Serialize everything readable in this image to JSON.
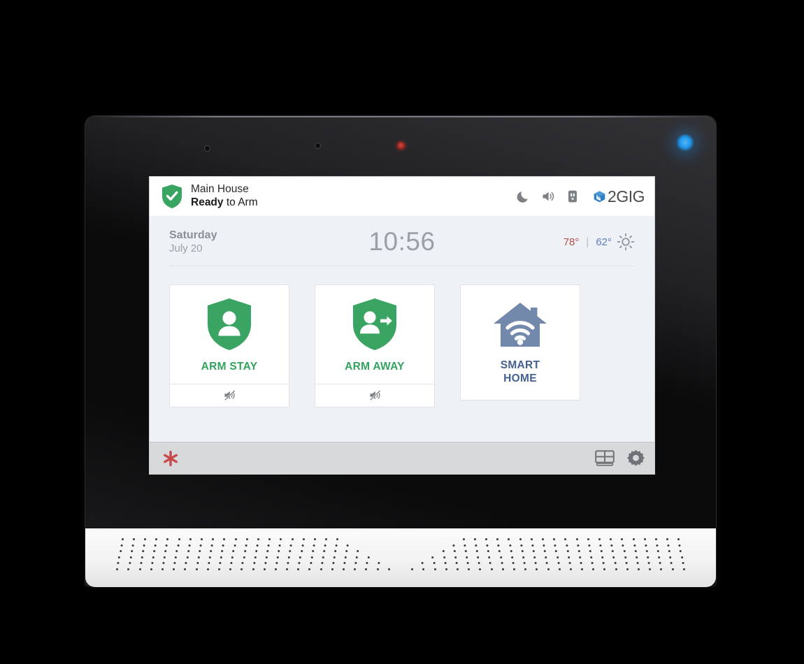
{
  "device": {
    "brand": "2GIG",
    "indicators": {
      "led_blue": "blue-status-led",
      "led_red": "red-status-led",
      "sensor_1": "ambient-light-sensor",
      "sensor_2": "microphone-hole"
    }
  },
  "header": {
    "site_name": "Main House",
    "status_prefix": "Ready",
    "status_suffix": " to Arm",
    "shield_icon": "shield-check-icon",
    "icons": [
      {
        "name": "night-mode-icon",
        "glyph": "moon"
      },
      {
        "name": "volume-icon",
        "glyph": "speaker"
      },
      {
        "name": "power-outlet-icon",
        "glyph": "outlet"
      }
    ],
    "brand_text": "2GIG",
    "brand_mark": "2gig-cube-logo"
  },
  "info_bar": {
    "day": "Saturday",
    "date": "July 20",
    "time": "10:56",
    "temp_high": "78°",
    "temp_divider": "|",
    "temp_low": "62°",
    "weather_icon": "sun-icon",
    "colors": {
      "temp_high": "#b5534b",
      "temp_low": "#5b7fbd"
    }
  },
  "tiles": [
    {
      "id": "arm-stay",
      "label": "ARM STAY",
      "icon": "shield-person-icon",
      "color": "#34a35f",
      "footer_icon": "mute-speaker-icon",
      "has_footer": true
    },
    {
      "id": "arm-away",
      "label": "ARM AWAY",
      "icon": "shield-person-arrow-icon",
      "color": "#34a35f",
      "footer_icon": "mute-speaker-icon",
      "has_footer": true
    },
    {
      "id": "smart-home",
      "label_line1": "SMART",
      "label_line2": "HOME",
      "icon": "house-wifi-icon",
      "color": "#44618f",
      "has_footer": false
    }
  ],
  "bottom_bar": {
    "emergency_icon": "emergency-asterisk-icon",
    "emergency_color": "#c8494a",
    "keypad_icon": "keypad-icon",
    "settings_icon": "gear-icon"
  }
}
